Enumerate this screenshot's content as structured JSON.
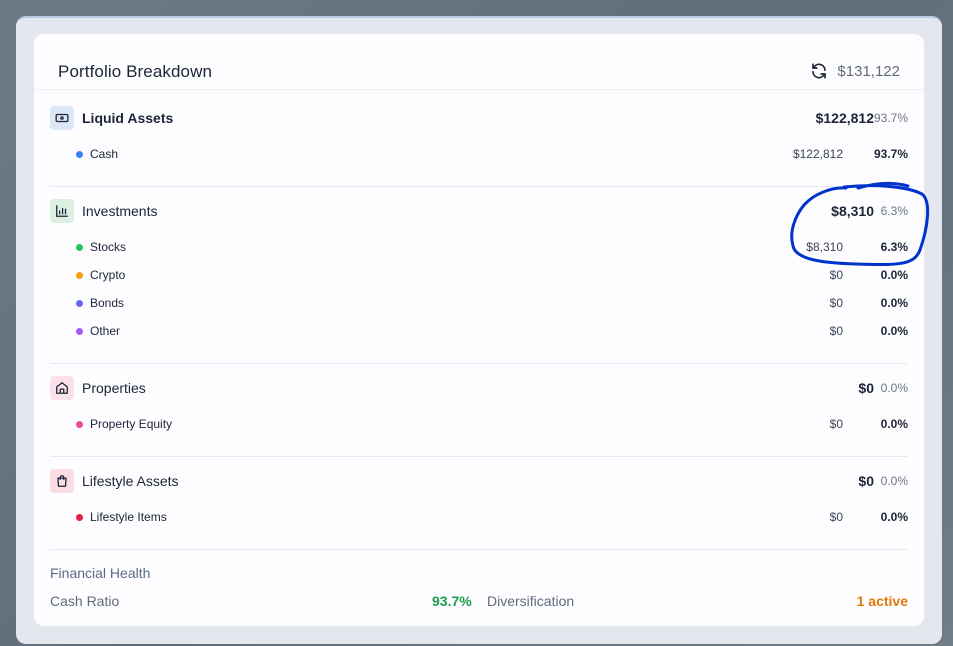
{
  "header": {
    "title": "Portfolio Breakdown",
    "total": "$131,122",
    "refresh_icon": "refresh-icon"
  },
  "sections": [
    {
      "name": "Liquid Assets",
      "amount": "$122,812",
      "pct": "93.7%",
      "icon": "banknote-icon",
      "icon_bg": "#dbe6f7",
      "icon_color": "#1c2538",
      "items": [
        {
          "name": "Cash",
          "amount": "$122,812",
          "pct": "93.7%",
          "color": "#3b82f6"
        }
      ]
    },
    {
      "name": "Investments",
      "amount": "$8,310",
      "pct": "6.3%",
      "icon": "bar-chart-icon",
      "icon_bg": "#dcefe0",
      "icon_color": "#1c2538",
      "items": [
        {
          "name": "Stocks",
          "amount": "$8,310",
          "pct": "6.3%",
          "color": "#22c55e"
        },
        {
          "name": "Crypto",
          "amount": "$0",
          "pct": "0.0%",
          "color": "#f59e0b"
        },
        {
          "name": "Bonds",
          "amount": "$0",
          "pct": "0.0%",
          "color": "#6366f1"
        },
        {
          "name": "Other",
          "amount": "$0",
          "pct": "0.0%",
          "color": "#a855f7"
        }
      ]
    },
    {
      "name": "Properties",
      "amount": "$0",
      "pct": "0.0%",
      "icon": "home-icon",
      "icon_bg": "#fbe1e8",
      "icon_color": "#1c2538",
      "items": [
        {
          "name": "Property Equity",
          "amount": "$0",
          "pct": "0.0%",
          "color": "#ec4899"
        }
      ]
    },
    {
      "name": "Lifestyle Assets",
      "amount": "$0",
      "pct": "0.0%",
      "icon": "shopping-bag-icon",
      "icon_bg": "#fbdde2",
      "icon_color": "#1c2538",
      "items": [
        {
          "name": "Lifestyle Items",
          "amount": "$0",
          "pct": "0.0%",
          "color": "#e11d48"
        }
      ]
    }
  ],
  "health": {
    "title": "Financial Health",
    "cash_ratio_label": "Cash Ratio",
    "cash_ratio_value": "93.7%",
    "diversification_label": "Diversification",
    "diversification_value": "1 active",
    "colors": {
      "good": "#1f9d4b",
      "warning": "#e07b0a"
    }
  },
  "annotation": {
    "type": "hand-drawn circle",
    "color": "#0033cc"
  }
}
